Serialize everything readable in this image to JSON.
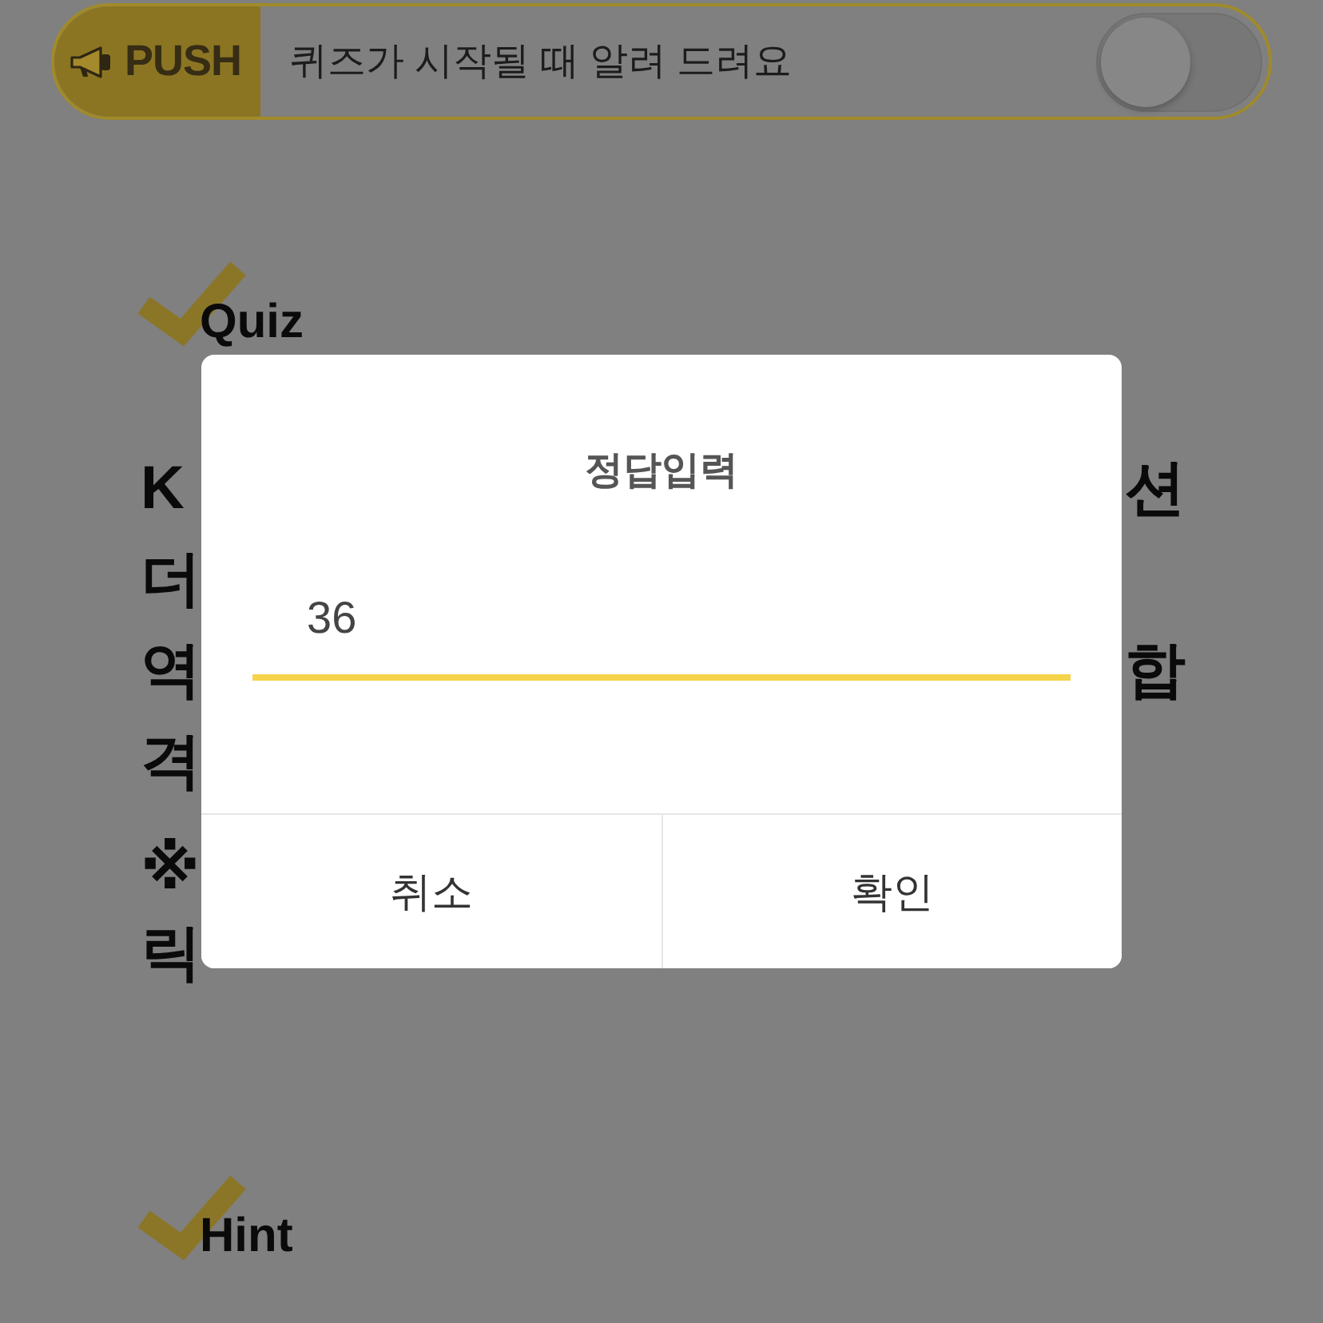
{
  "push": {
    "label": "PUSH",
    "text": "퀴즈가 시작될 때 알려 드려요",
    "on": false
  },
  "quiz": {
    "heading": "Quiz",
    "paragraphs": [
      {
        "lines": [
          {
            "left": "K",
            "right": "션"
          },
          {
            "left": "더"
          },
          {
            "left": "역",
            "right": "합"
          },
          {
            "left": "격"
          }
        ]
      },
      {
        "lines": [
          {
            "left": "※"
          },
          {
            "left": "릭"
          }
        ]
      }
    ]
  },
  "hint": {
    "heading": "Hint"
  },
  "dialog": {
    "title": "정답입력",
    "answer": {
      "value": "36"
    },
    "buttons": [
      "취소",
      "확인"
    ]
  }
}
